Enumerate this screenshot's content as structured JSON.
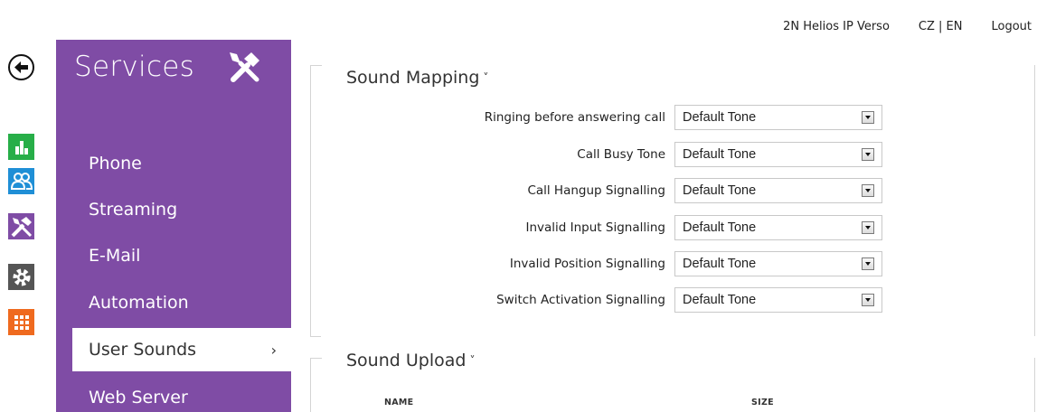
{
  "header": {
    "device": "2N Helios IP Verso",
    "language": "CZ | EN",
    "logout": "Logout"
  },
  "rail": {
    "icons": [
      "back-icon",
      "status-icon",
      "directory-icon",
      "services-icon",
      "settings-icon",
      "apps-icon"
    ],
    "colors": {
      "status": "#27ae48",
      "directory": "#1f8fd6",
      "services": "#7f4ca5",
      "settings": "#555555",
      "apps": "#ef6a1f"
    }
  },
  "sidebar": {
    "title": "Services",
    "color": "#7f4ca5",
    "items": [
      {
        "label": "Phone"
      },
      {
        "label": "Streaming"
      },
      {
        "label": "E-Mail"
      },
      {
        "label": "Automation"
      },
      {
        "label": "User Sounds",
        "active": true,
        "chevron": "›"
      },
      {
        "label": "Web Server"
      }
    ]
  },
  "sound_mapping": {
    "title": "Sound Mapping",
    "caret": "˅",
    "rows": [
      {
        "label": "Ringing before answering call",
        "value": "Default Tone"
      },
      {
        "label": "Call Busy Tone",
        "value": "Default Tone"
      },
      {
        "label": "Call Hangup Signalling",
        "value": "Default Tone"
      },
      {
        "label": "Invalid Input Signalling",
        "value": "Default Tone"
      },
      {
        "label": "Invalid Position Signalling",
        "value": "Default Tone"
      },
      {
        "label": "Switch Activation Signalling",
        "value": "Default Tone"
      }
    ]
  },
  "sound_upload": {
    "title": "Sound Upload",
    "caret": "˅",
    "columns": [
      "NAME",
      "SIZE"
    ]
  }
}
